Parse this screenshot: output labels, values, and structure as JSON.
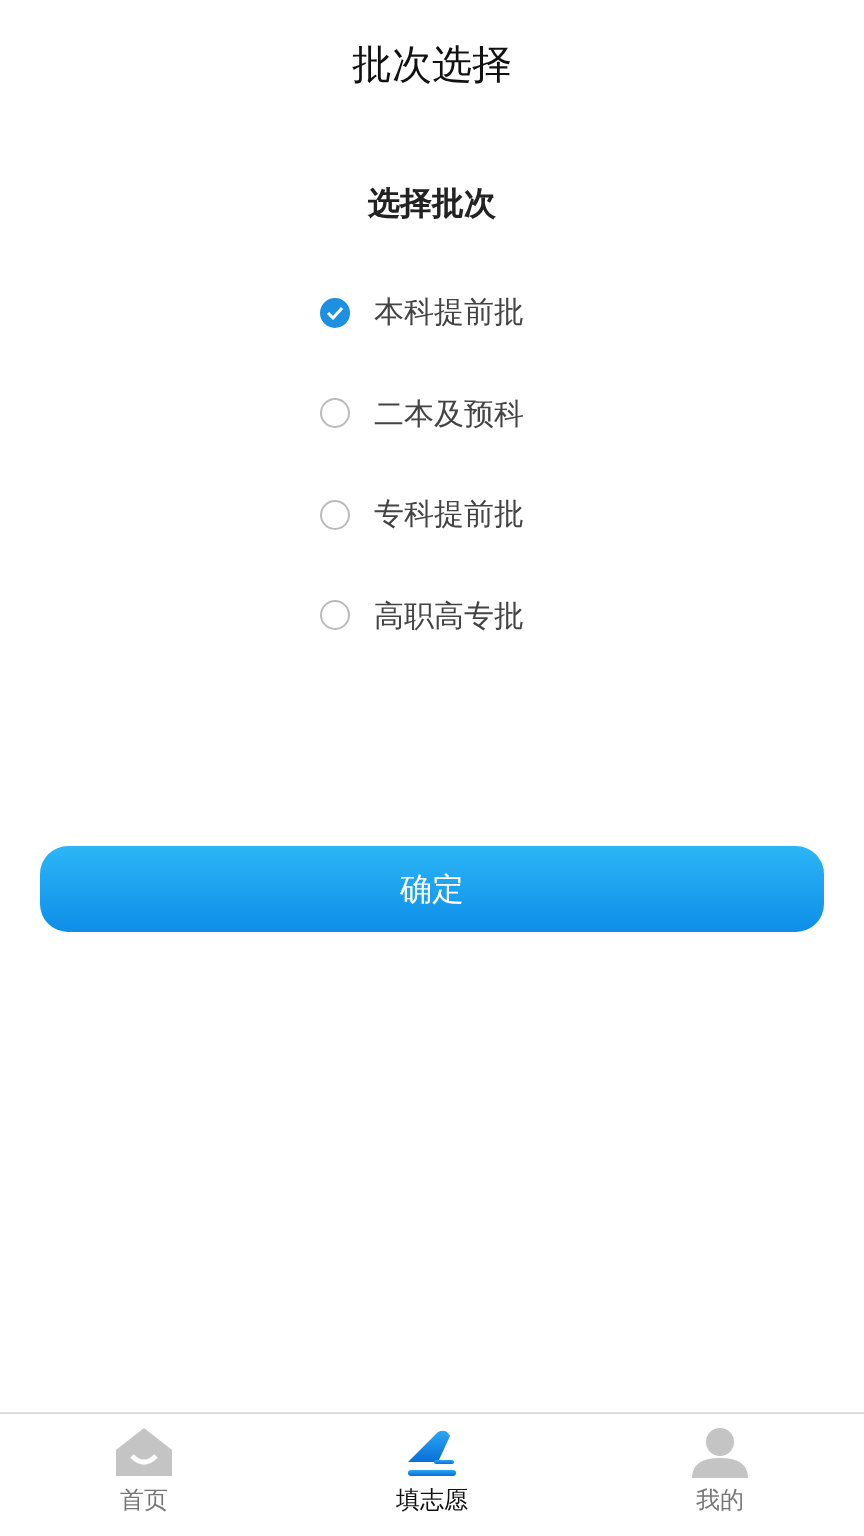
{
  "header": {
    "title": "批次选择"
  },
  "section": {
    "heading": "选择批次"
  },
  "options": [
    {
      "label": "本科提前批",
      "selected": true
    },
    {
      "label": "二本及预科",
      "selected": false
    },
    {
      "label": "专科提前批",
      "selected": false
    },
    {
      "label": "高职高专批",
      "selected": false
    }
  ],
  "confirm_button": {
    "label": "确定"
  },
  "tab_bar": [
    {
      "kind": "home",
      "label": "首页",
      "selected": false
    },
    {
      "kind": "apply",
      "label": "填志愿",
      "selected": true
    },
    {
      "kind": "profile",
      "label": "我的",
      "selected": false
    }
  ]
}
